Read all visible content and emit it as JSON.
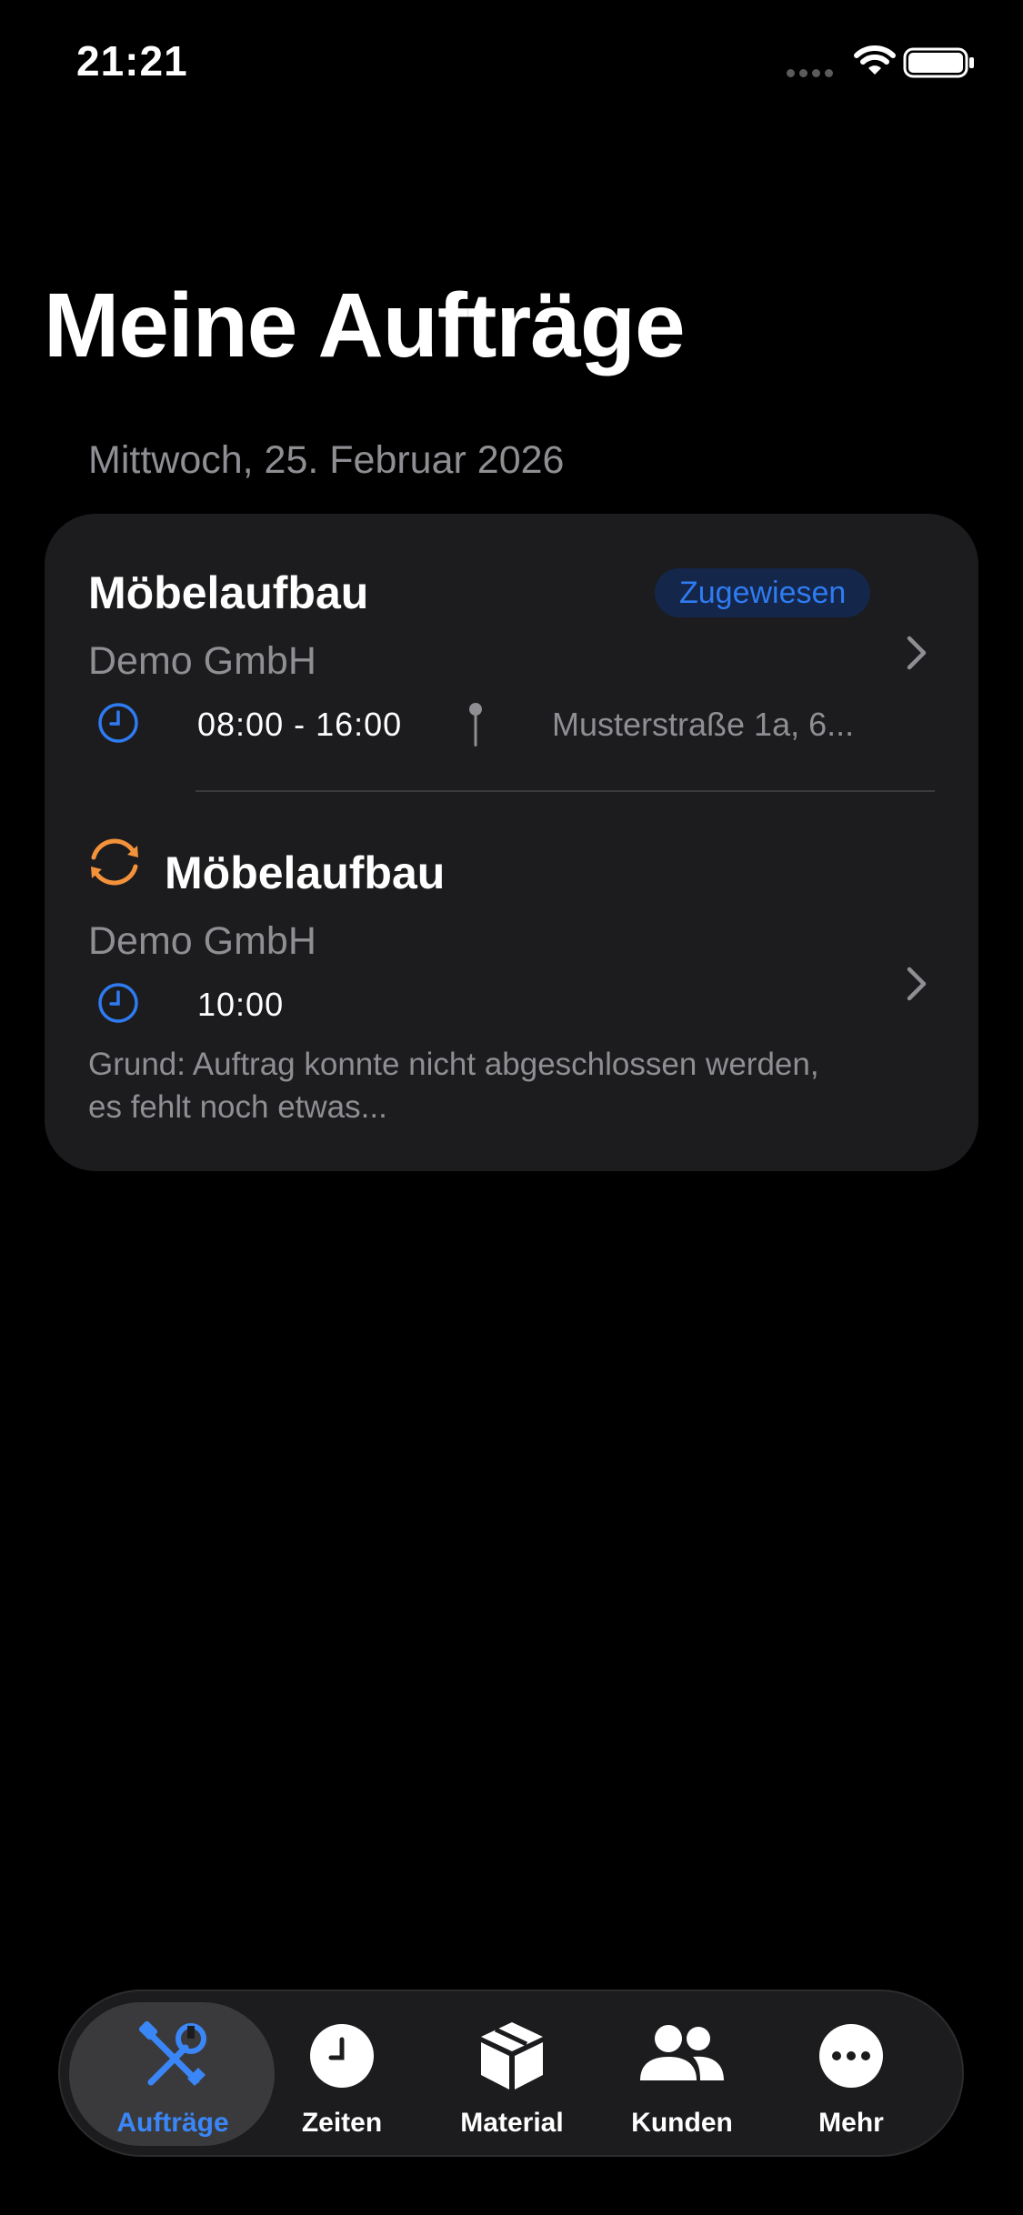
{
  "status_bar": {
    "time": "21:21"
  },
  "header": {
    "title": "Meine Aufträge",
    "date": "Mittwoch, 25. Februar 2026"
  },
  "orders": [
    {
      "title": "Möbelaufbau",
      "customer": "Demo GmbH",
      "time": "08:00 - 16:00",
      "address": "Musterstraße 1a, 6...",
      "status_badge": "Zugewiesen",
      "icons": [
        "clock-icon",
        "map-pin-icon",
        "chevron-right-icon"
      ]
    },
    {
      "title": "Möbelaufbau",
      "customer": "Demo GmbH",
      "time": "10:00",
      "reason": "Grund: Auftrag konnte nicht abgeschlossen werden, es fehlt noch etwas...",
      "icons": [
        "sync-icon",
        "clock-icon",
        "chevron-right-icon"
      ]
    }
  ],
  "tab_bar": {
    "tabs": [
      {
        "label": "Aufträge",
        "icon": "tools-icon",
        "active": true
      },
      {
        "label": "Zeiten",
        "icon": "clock-icon"
      },
      {
        "label": "Material",
        "icon": "box-icon"
      },
      {
        "label": "Kunden",
        "icon": "people-icon"
      },
      {
        "label": "Mehr",
        "icon": "more-icon"
      }
    ]
  },
  "colors": {
    "background": "#000000",
    "card": "#1c1c1e",
    "accent_blue": "#2f7bf2",
    "accent_orange": "#f3923a",
    "secondary_text": "#8e8e93"
  }
}
